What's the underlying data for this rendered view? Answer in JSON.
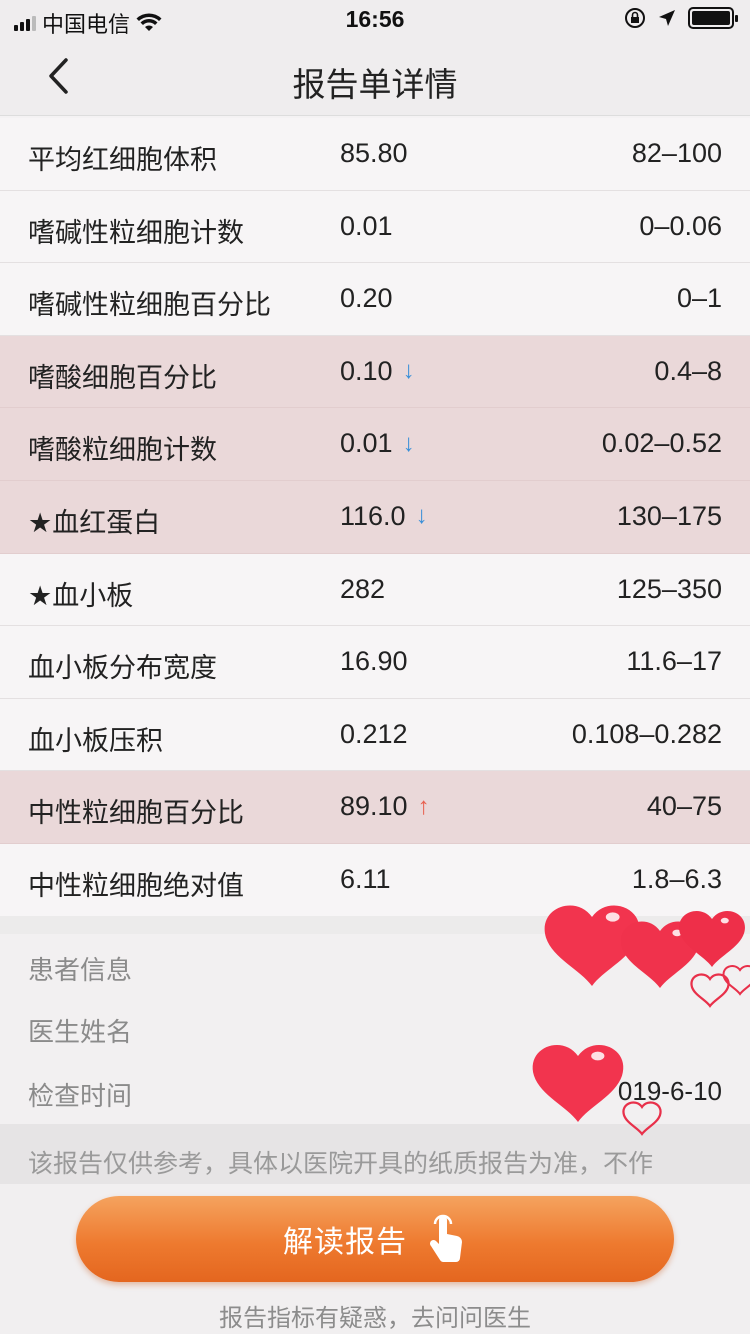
{
  "status_bar": {
    "carrier": "中国电信",
    "time": "16:56"
  },
  "nav": {
    "title": "报告单详情"
  },
  "results": [
    {
      "name": "平均红细胞体积",
      "value": "85.80",
      "flag": "",
      "range": "82–100",
      "abnormal": false
    },
    {
      "name": "嗜碱性粒细胞计数",
      "value": "0.01",
      "flag": "",
      "range": "0–0.06",
      "abnormal": false
    },
    {
      "name": "嗜碱性粒细胞百分比",
      "value": "0.20",
      "flag": "",
      "range": "0–1",
      "abnormal": false
    },
    {
      "name": "嗜酸细胞百分比",
      "value": "0.10",
      "flag": "↓",
      "range": "0.4–8",
      "abnormal": true
    },
    {
      "name": "嗜酸粒细胞计数",
      "value": "0.01",
      "flag": "↓",
      "range": "0.02–0.52",
      "abnormal": true
    },
    {
      "name": "★血红蛋白",
      "value": "116.0",
      "flag": "↓",
      "range": "130–175",
      "abnormal": true
    },
    {
      "name": "★血小板",
      "value": "282",
      "flag": "",
      "range": "125–350",
      "abnormal": false
    },
    {
      "name": "血小板分布宽度",
      "value": "16.90",
      "flag": "",
      "range": "11.6–17",
      "abnormal": false
    },
    {
      "name": "血小板压积",
      "value": "0.212",
      "flag": "",
      "range": "0.108–0.282",
      "abnormal": false
    },
    {
      "name": "中性粒细胞百分比",
      "value": "89.10",
      "flag": "↑",
      "range": "40–75",
      "abnormal": true
    },
    {
      "name": "中性粒细胞绝对值",
      "value": "6.11",
      "flag": "",
      "range": "1.8–6.3",
      "abnormal": false
    }
  ],
  "info": {
    "patient_label": "患者信息",
    "doctor_label": "医生姓名",
    "exam_time_label": "检查时间",
    "exam_time_value": "019-6-10"
  },
  "disclaimer": "该报告仅供参考，具体以医院开具的纸质报告为准，不作",
  "footer": {
    "read_button": "解读报告",
    "hint": "报告指标有疑惑，去问问医生"
  },
  "colors": {
    "abnormal_row": "#ead8d9",
    "arrow_down": "#3a8fd8",
    "arrow_up": "#e8604f",
    "button": "#ee7a2f"
  }
}
